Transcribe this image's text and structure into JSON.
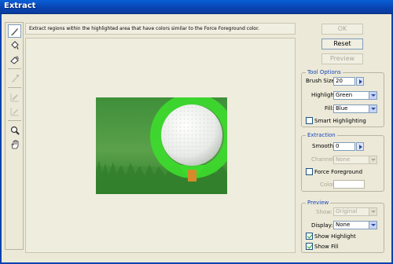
{
  "window": {
    "title": "Extract"
  },
  "hint": "Extract regions within the highlighted area that have colors similar to the Force Foreground color.",
  "buttons": {
    "ok": "OK",
    "reset": "Reset",
    "preview": "Preview"
  },
  "tool_options": {
    "legend": "Tool Options",
    "brush_size_label": "Brush Size:",
    "brush_size_value": "20",
    "highlight_label": "Highlight:",
    "highlight_value": "Green",
    "fill_label": "Fill:",
    "fill_value": "Blue",
    "smart_highlighting_label": "Smart Highlighting",
    "smart_highlighting_checked": false
  },
  "extraction": {
    "legend": "Extraction",
    "smooth_label": "Smooth:",
    "smooth_value": "0",
    "channel_label": "Channel:",
    "channel_value": "None",
    "force_foreground_label": "Force Foreground",
    "force_foreground_checked": false,
    "color_label": "Color:"
  },
  "preview_group": {
    "legend": "Preview",
    "show_label": "Show:",
    "show_value": "Original",
    "display_label": "Display:",
    "display_value": "None",
    "show_highlight_label": "Show Highlight",
    "show_highlight_checked": true,
    "show_fill_label": "Show Fill",
    "show_fill_checked": true
  },
  "tools": [
    {
      "name": "edge-highlighter-tool-icon",
      "selected": true,
      "enabled": true
    },
    {
      "name": "fill-tool-icon",
      "selected": false,
      "enabled": true
    },
    {
      "name": "eraser-tool-icon",
      "selected": false,
      "enabled": true
    },
    {
      "name": "eyedropper-tool-icon",
      "selected": false,
      "enabled": false
    },
    {
      "name": "cleanup-tool-icon",
      "selected": false,
      "enabled": false
    },
    {
      "name": "edge-touchup-tool-icon",
      "selected": false,
      "enabled": false
    },
    {
      "name": "zoom-tool-icon",
      "selected": false,
      "enabled": true
    },
    {
      "name": "hand-tool-icon",
      "selected": false,
      "enabled": true
    }
  ],
  "colors": {
    "title_bar": "#0842b0",
    "highlight": "#3ddc2e",
    "group_legend": "#1a47b7"
  }
}
